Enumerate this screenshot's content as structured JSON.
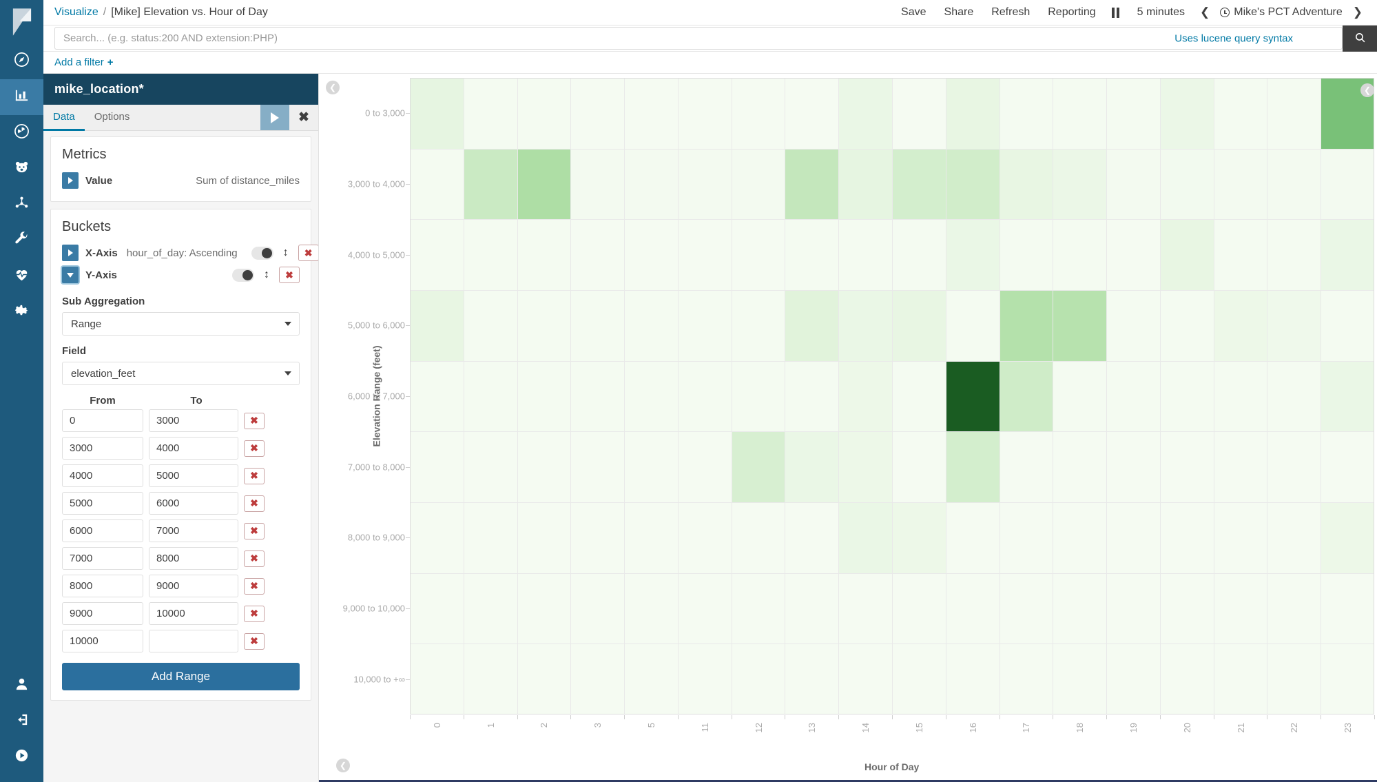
{
  "rail": {
    "items": [
      {
        "name": "discover",
        "icon": "compass-icon"
      },
      {
        "name": "visualize",
        "icon": "bar-chart-icon",
        "active": true
      },
      {
        "name": "dashboard",
        "icon": "dashboard-dial-icon"
      },
      {
        "name": "timelion",
        "icon": "bear-icon"
      },
      {
        "name": "graph",
        "icon": "molecule-icon"
      },
      {
        "name": "dev-tools",
        "icon": "wrench-icon"
      },
      {
        "name": "monitoring",
        "icon": "heartbeat-icon"
      },
      {
        "name": "management",
        "icon": "gear-icon"
      }
    ],
    "bottom": [
      {
        "name": "user",
        "icon": "user-icon"
      },
      {
        "name": "logout",
        "icon": "logout-icon"
      },
      {
        "name": "collapse",
        "icon": "play-circle-icon"
      }
    ]
  },
  "breadcrumb": {
    "parent": "Visualize",
    "separator": "/",
    "current": "[Mike] Elevation vs. Hour of Day"
  },
  "topnav": {
    "save": "Save",
    "share": "Share",
    "refresh": "Refresh",
    "reporting": "Reporting",
    "pause_icon": "pause-icon",
    "interval": "5 minutes",
    "prev_icon": "chevron-left-icon",
    "clock_icon": "clock-icon",
    "time_range": "Mike's PCT Adventure",
    "next_icon": "chevron-right-icon"
  },
  "search": {
    "placeholder": "Search... (e.g. status:200 AND extension:PHP)",
    "value": "",
    "hint": "Uses lucene query syntax",
    "button_icon": "search-icon"
  },
  "filters": {
    "add_label": "Add a filter",
    "plus": "+"
  },
  "editor": {
    "index_pattern": "mike_location*",
    "tabs": [
      {
        "label": "Data",
        "active": true
      },
      {
        "label": "Options",
        "active": false
      }
    ],
    "apply_icon": "play-icon",
    "close_icon": "close-icon",
    "metrics": {
      "heading": "Metrics",
      "rows": [
        {
          "label": "Value",
          "detail": "Sum of distance_miles",
          "expanded": false
        }
      ]
    },
    "buckets": {
      "heading": "Buckets",
      "rows": [
        {
          "label": "X-Axis",
          "detail": "hour_of_day: Ascending",
          "expanded": false
        },
        {
          "label": "Y-Axis",
          "detail": "",
          "expanded": true
        }
      ]
    },
    "sub_aggregation": {
      "label": "Sub Aggregation",
      "value": "Range"
    },
    "field": {
      "label": "Field",
      "value": "elevation_feet"
    },
    "range_headers": {
      "from": "From",
      "to": "To"
    },
    "ranges": [
      {
        "from": "0",
        "to": "3000"
      },
      {
        "from": "3000",
        "to": "4000"
      },
      {
        "from": "4000",
        "to": "5000"
      },
      {
        "from": "5000",
        "to": "6000"
      },
      {
        "from": "6000",
        "to": "7000"
      },
      {
        "from": "7000",
        "to": "8000"
      },
      {
        "from": "8000",
        "to": "9000"
      },
      {
        "from": "9000",
        "to": "10000"
      },
      {
        "from": "10000",
        "to": ""
      }
    ],
    "add_range_label": "Add Range"
  },
  "chart_data": {
    "type": "heatmap",
    "title": "[Mike] Elevation vs. Hour of Day",
    "xlabel": "Hour of Day",
    "ylabel": "Elevation Range (feet)",
    "metric": "Sum of distance_miles",
    "grid": true,
    "legend": "bottom",
    "color_scale": {
      "min_color": "#f7fcf5",
      "max_color": "#1a5c22",
      "stops": [
        "#f7fcf5",
        "#e8f6e3",
        "#d6efd0",
        "#b7e2ae",
        "#8fd184",
        "#4da360",
        "#24703a",
        "#1a5c22"
      ]
    },
    "x": [
      "0",
      "1",
      "2",
      "3",
      "5",
      "11",
      "12",
      "13",
      "14",
      "15",
      "16",
      "17",
      "18",
      "19",
      "20",
      "21",
      "22",
      "23"
    ],
    "y": [
      "0 to 3,000",
      "3,000 to 4,000",
      "4,000 to 5,000",
      "5,000 to 6,000",
      "6,000 to 7,000",
      "7,000 to 8,000",
      "8,000 to 9,000",
      "9,000 to 10,000",
      "10,000 to +∞"
    ],
    "values": [
      [
        0.16,
        0.03,
        0.03,
        0.02,
        0.02,
        0.02,
        0.02,
        0.02,
        0.12,
        0.02,
        0.14,
        0.03,
        0.03,
        0.03,
        0.11,
        0.03,
        0.03,
        0.62
      ],
      [
        0.03,
        0.34,
        0.46,
        0.04,
        0.04,
        0.04,
        0.04,
        0.37,
        0.16,
        0.3,
        0.31,
        0.14,
        0.11,
        0.04,
        0.05,
        0.04,
        0.04,
        0.04
      ],
      [
        0.03,
        0.03,
        0.03,
        0.02,
        0.02,
        0.02,
        0.02,
        0.03,
        0.03,
        0.03,
        0.12,
        0.03,
        0.03,
        0.02,
        0.14,
        0.03,
        0.03,
        0.12
      ],
      [
        0.14,
        0.03,
        0.03,
        0.03,
        0.03,
        0.03,
        0.03,
        0.2,
        0.12,
        0.14,
        0.03,
        0.44,
        0.43,
        0.03,
        0.03,
        0.1,
        0.08,
        0.03
      ],
      [
        0.03,
        0.03,
        0.03,
        0.03,
        0.03,
        0.03,
        0.03,
        0.03,
        0.1,
        0.03,
        1.0,
        0.32,
        0.03,
        0.03,
        0.03,
        0.03,
        0.03,
        0.12
      ],
      [
        0.02,
        0.02,
        0.02,
        0.02,
        0.02,
        0.02,
        0.28,
        0.12,
        0.1,
        0.02,
        0.3,
        0.02,
        0.02,
        0.02,
        0.02,
        0.02,
        0.02,
        0.02
      ],
      [
        0.02,
        0.02,
        0.02,
        0.02,
        0.02,
        0.02,
        0.02,
        0.02,
        0.12,
        0.1,
        0.02,
        0.02,
        0.02,
        0.02,
        0.02,
        0.02,
        0.02,
        0.1
      ],
      [
        0.02,
        0.02,
        0.02,
        0.02,
        0.02,
        0.02,
        0.02,
        0.02,
        0.02,
        0.02,
        0.02,
        0.02,
        0.02,
        0.02,
        0.02,
        0.02,
        0.02,
        0.02
      ],
      [
        0.02,
        0.02,
        0.02,
        0.02,
        0.02,
        0.02,
        0.02,
        0.02,
        0.02,
        0.02,
        0.02,
        0.02,
        0.02,
        0.02,
        0.02,
        0.02,
        0.02,
        0.02
      ]
    ]
  },
  "panel_controls": {
    "collapse_left_icon": "chevron-left-circle-icon",
    "collapse_right_icon": "chevron-left-circle-icon",
    "collapse_bottom_icon": "chevron-up-circle-icon"
  }
}
